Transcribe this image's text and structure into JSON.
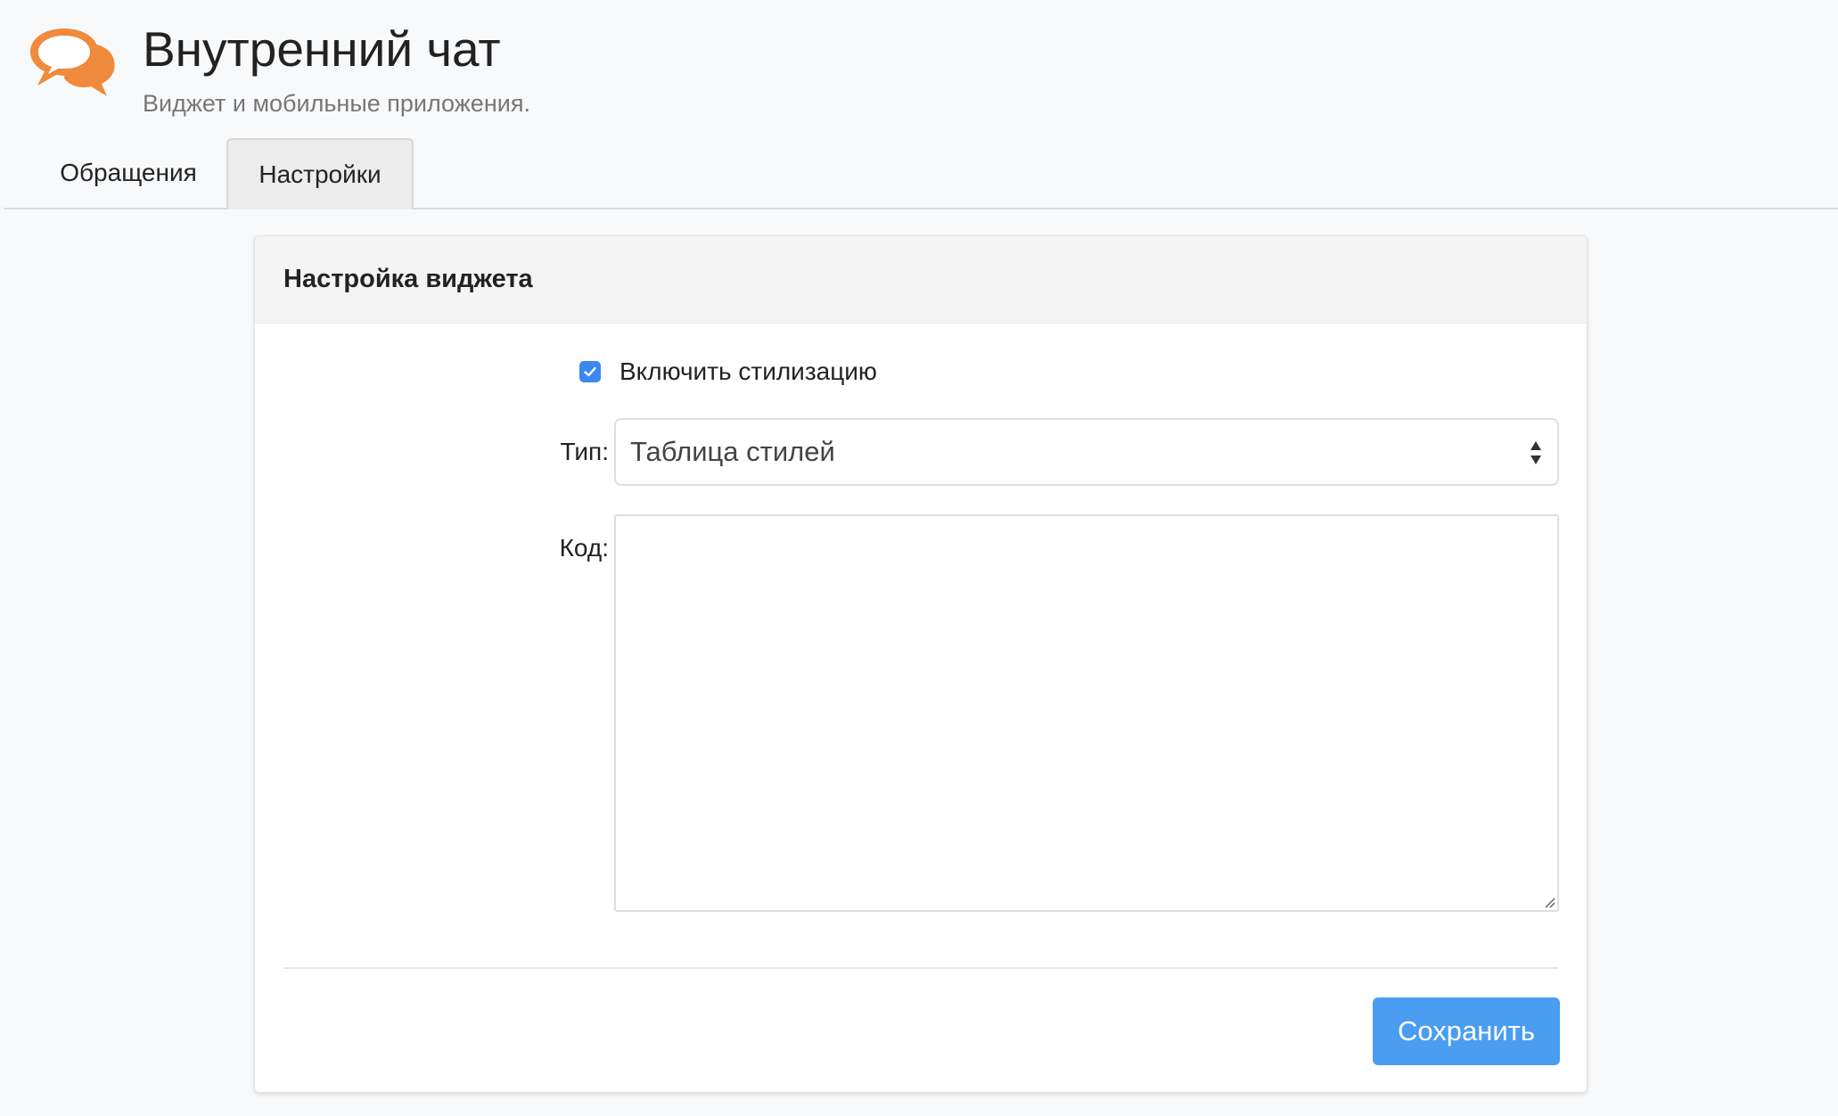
{
  "app": {
    "title": "Внутренний чат",
    "subtitle": "Виджет и мобильные приложения.",
    "logo_icon": "chat-bubbles-icon",
    "accent_color": "#f08a3c"
  },
  "tabs": [
    {
      "label": "Обращения",
      "active": false
    },
    {
      "label": "Настройки",
      "active": true
    }
  ],
  "card": {
    "title": "Настройка виджета",
    "enable_styling": {
      "label": "Включить стилизацию",
      "checked": true
    },
    "type_field": {
      "label": "Тип:",
      "value": "Таблица стилей"
    },
    "code_field": {
      "label": "Код:",
      "value": ""
    },
    "save_label": "Сохранить",
    "button_color": "#4a9df0"
  }
}
